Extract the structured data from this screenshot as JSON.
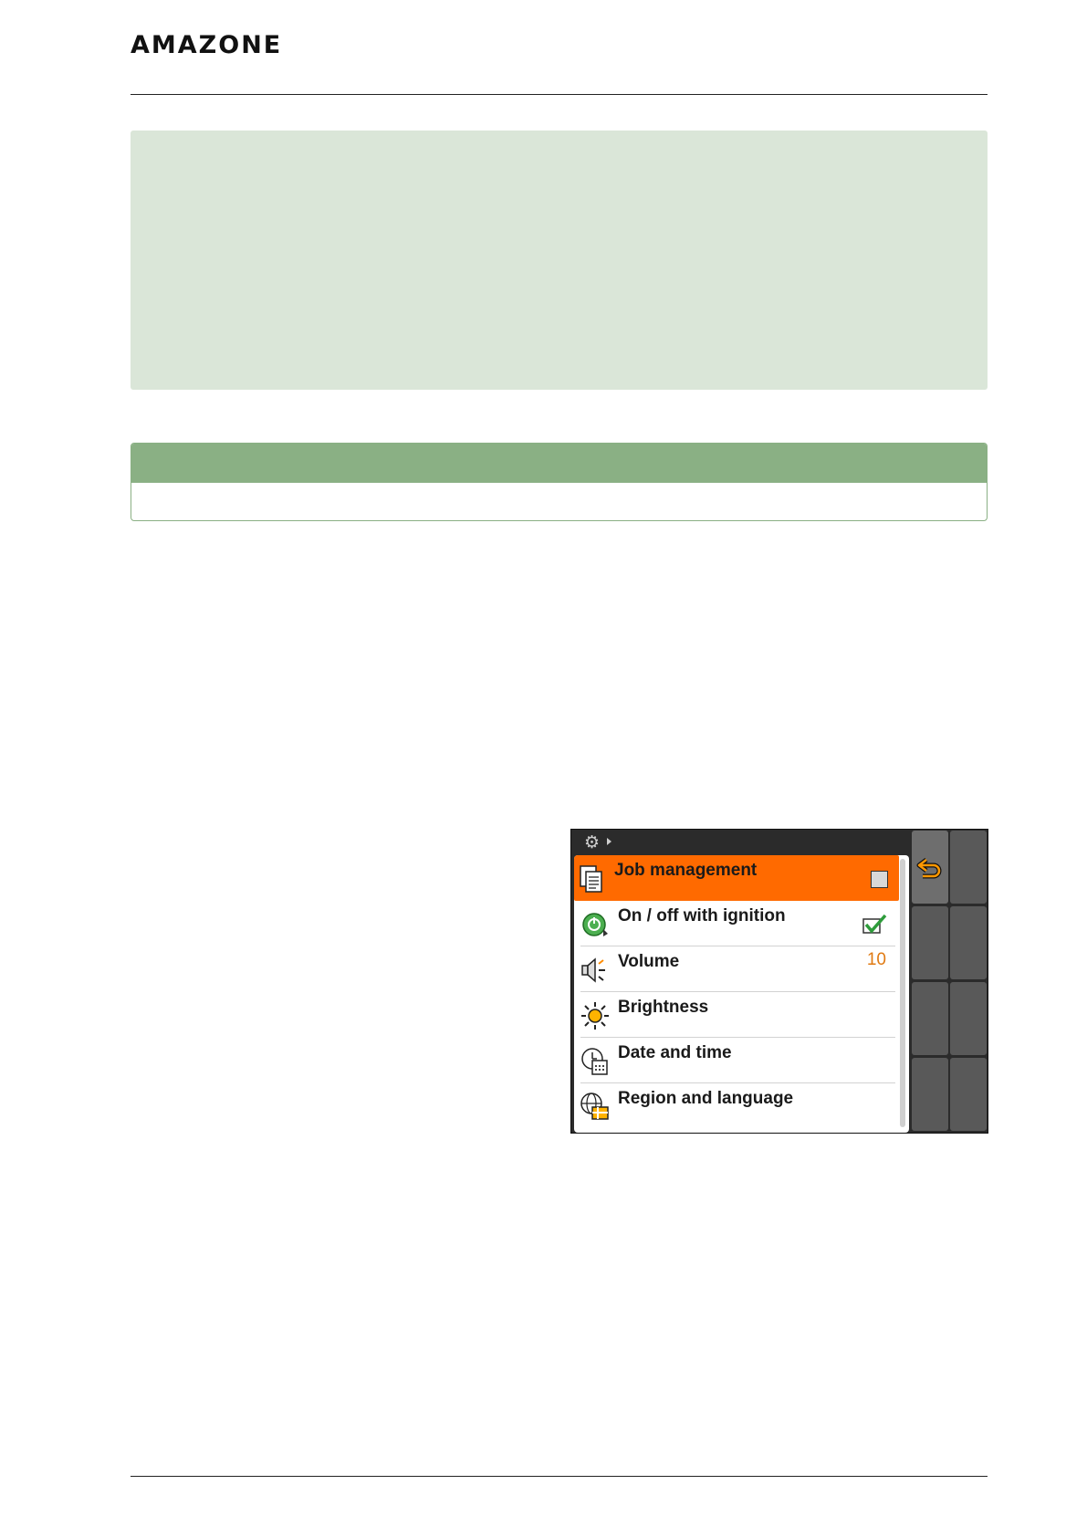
{
  "header": {
    "logo_text": "AMAZONE"
  },
  "terminal": {
    "icons": {
      "topbar": "settings-gear-icon",
      "back": "back-arrow-icon"
    },
    "accent_color": "#ff6a00",
    "menu": [
      {
        "label": "Job management",
        "icon": "job-management-icon",
        "control": "checkbox",
        "checked": false,
        "selected": true
      },
      {
        "label": "On / off with ignition",
        "icon": "ignition-icon",
        "control": "checkmark",
        "checked": true,
        "selected": false
      },
      {
        "label": "Volume",
        "icon": "volume-icon",
        "value": "10",
        "selected": false
      },
      {
        "label": "Brightness",
        "icon": "brightness-icon",
        "selected": false
      },
      {
        "label": "Date and time",
        "icon": "date-time-icon",
        "selected": false
      },
      {
        "label": "Region and language",
        "icon": "region-language-icon",
        "selected": false
      }
    ]
  }
}
